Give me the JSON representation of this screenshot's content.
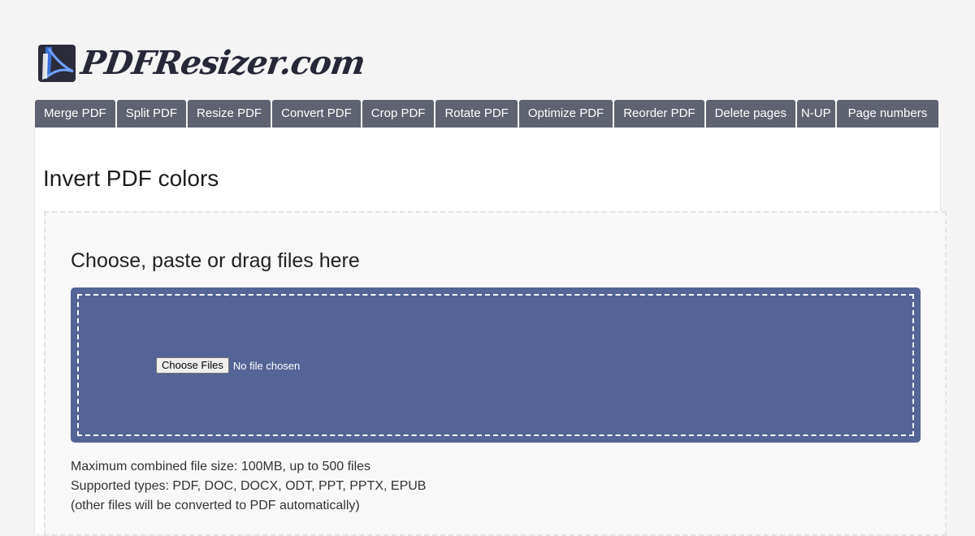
{
  "site": {
    "logo_text": "PDFResizer.com",
    "logo_icon": "acrobat-pdf-icon",
    "accent_color": "#556496",
    "tab_color": "#5f6270"
  },
  "nav": {
    "tabs": [
      "Merge PDF",
      "Split PDF",
      "Resize PDF",
      "Convert PDF",
      "Crop PDF",
      "Rotate PDF",
      "Optimize PDF",
      "Reorder PDF",
      "Delete pages",
      "N-UP",
      "Page numbers"
    ]
  },
  "main": {
    "title": "Invert PDF colors",
    "upload": {
      "heading": "Choose, paste or drag files here",
      "button_label": "Choose Files",
      "status": "No file chosen"
    },
    "info_lines": [
      "Maximum combined file size: 100MB, up to 500 files",
      "Supported types: PDF, DOC, DOCX, ODT, PPT, PPTX, EPUB",
      "(other files will be converted to PDF automatically)"
    ]
  }
}
